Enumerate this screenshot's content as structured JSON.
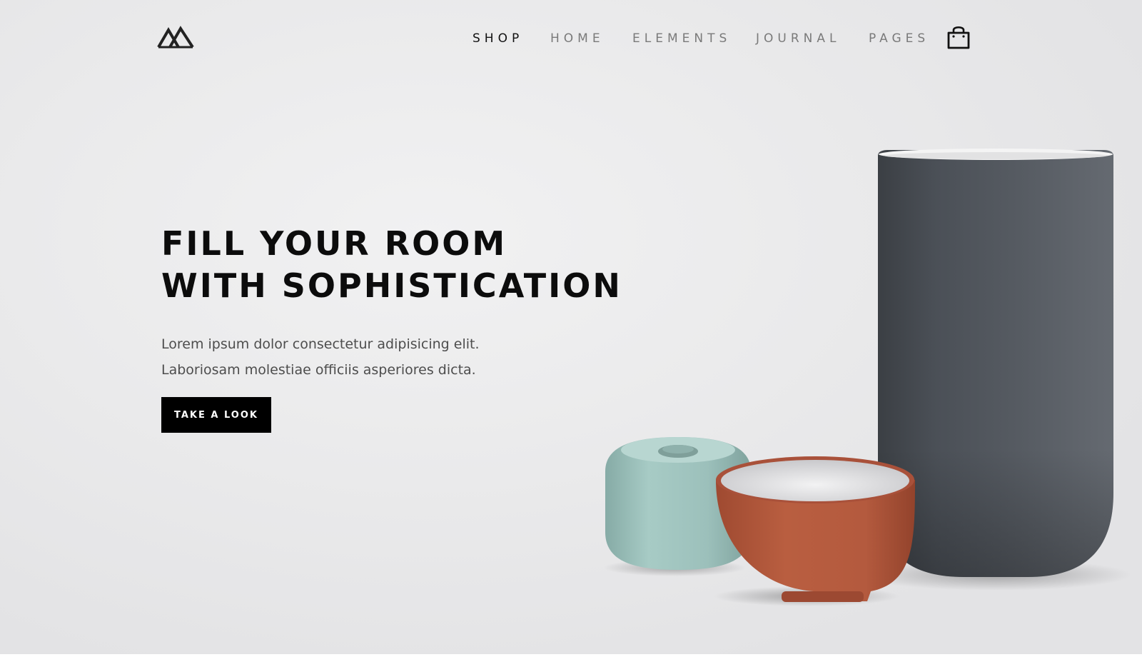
{
  "header": {
    "nav": [
      {
        "label": "SHOP",
        "active": true
      },
      {
        "label": "HOME",
        "active": false
      },
      {
        "label": "ELEMENTS",
        "active": false
      },
      {
        "label": "JOURNAL",
        "active": false
      },
      {
        "label": "PAGES",
        "active": false
      }
    ],
    "logo_icon": "mountain-logo",
    "cart_icon": "shopping-bag-icon"
  },
  "hero": {
    "headline_line1": "FILL YOUR ROOM",
    "headline_line2": "WITH SOPHISTICATION",
    "lead_line1": "Lorem ipsum dolor consectetur adipisicing elit.",
    "lead_line2": "Laboriosam molestiae officiis asperiores dicta.",
    "cta_label": "TAKE A LOOK"
  },
  "colors": {
    "background": "#e7e7e8",
    "text": "#0c0c0c",
    "nav_inactive": "#7a7a7a",
    "button": "#000000",
    "vase": "#4a4f56",
    "bowl": "#b45a3e",
    "candle_holder": "#9cc0bb"
  }
}
